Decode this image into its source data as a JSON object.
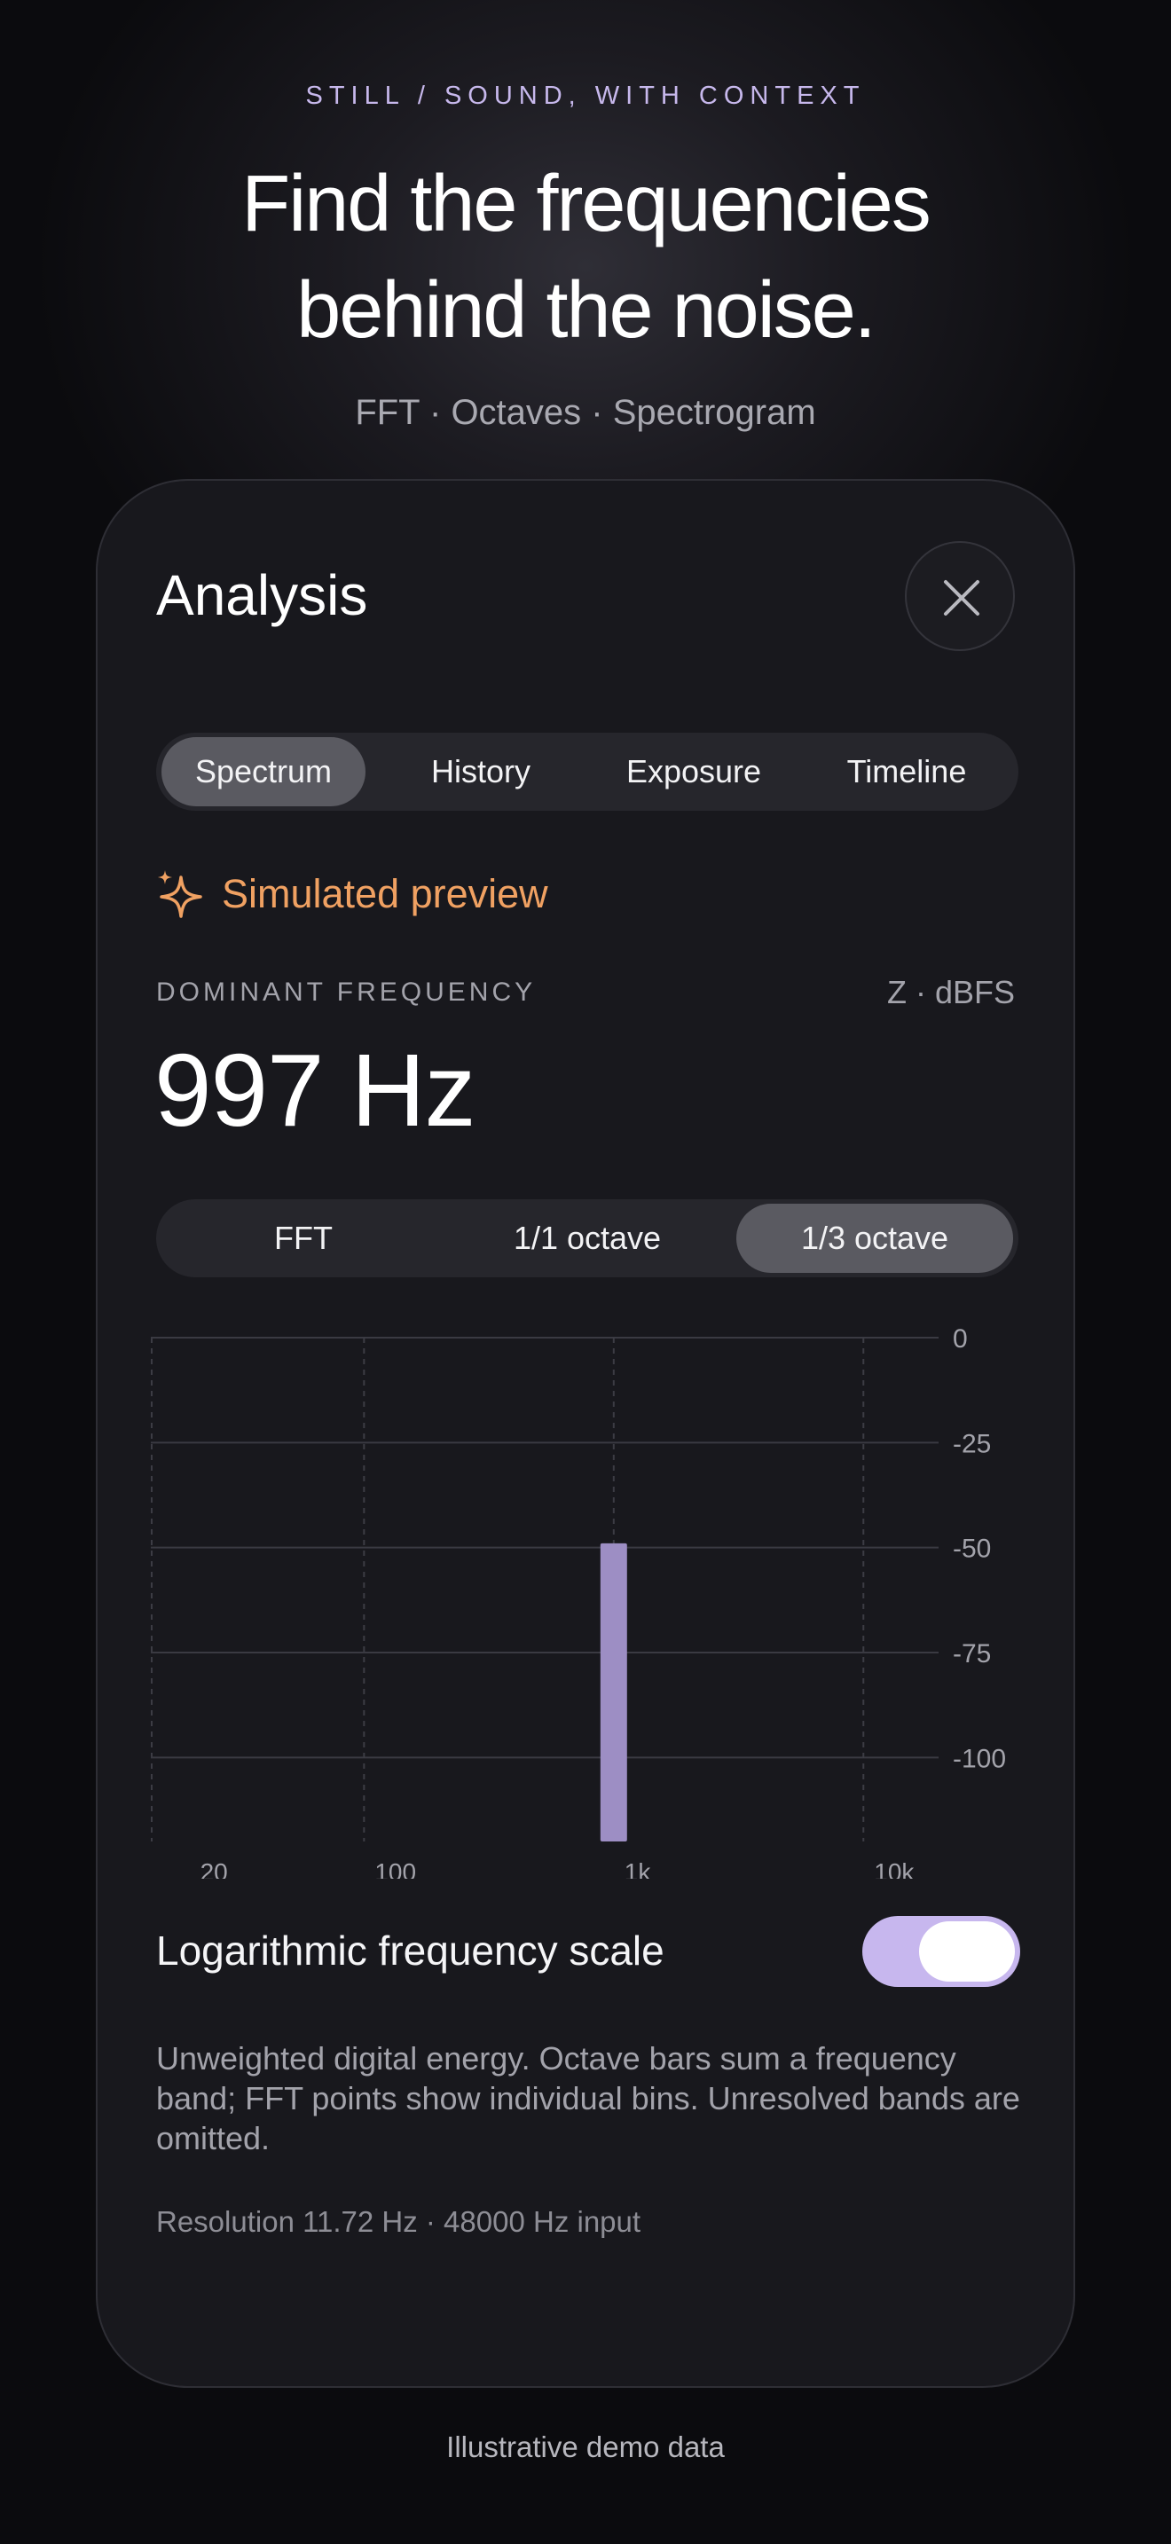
{
  "hero": {
    "eyebrow": "STILL / SOUND, WITH CONTEXT",
    "headline_line1": "Find the frequencies",
    "headline_line2": "behind the noise.",
    "subline": "FFT · Octaves · Spectrogram"
  },
  "panel": {
    "title": "Analysis",
    "close_icon": "close-icon",
    "tabs": [
      {
        "label": "Spectrum",
        "active": true
      },
      {
        "label": "History",
        "active": false
      },
      {
        "label": "Exposure",
        "active": false
      },
      {
        "label": "Timeline",
        "active": false
      }
    ],
    "preview_label": "Simulated preview",
    "preview_icon": "sparkles-icon",
    "dominant_label": "DOMINANT FREQUENCY",
    "weighting": "Z · dBFS",
    "dominant_value": "997 Hz",
    "modes": [
      {
        "label": "FFT",
        "active": false
      },
      {
        "label": "1/1 octave",
        "active": false
      },
      {
        "label": "1/3 octave",
        "active": true
      }
    ],
    "toggle_label": "Logarithmic frequency scale",
    "toggle_on": true,
    "description": "Unweighted digital energy. Octave bars sum a frequency band; FFT points show individual bins. Unresolved bands are omitted.",
    "resolution": "Resolution 11.72 Hz · 48000 Hz input"
  },
  "footer": "Illustrative demo data",
  "colors": {
    "accent": "#c7b7ee",
    "bar": "#9d8ec4",
    "preview": "#f0a162",
    "card": "#18181d"
  },
  "chart_data": {
    "type": "bar",
    "x_scale": "log",
    "xlim": [
      14,
      20000
    ],
    "ylim": [
      -120,
      0
    ],
    "x_ticks": [
      20,
      100,
      1000,
      10000
    ],
    "x_tick_labels": [
      "20",
      "100",
      "1k",
      "10k"
    ],
    "y_ticks": [
      0,
      -25,
      -50,
      -75,
      -100
    ],
    "y_tick_labels": [
      "0",
      "-25",
      "-50",
      "-75",
      "-100"
    ],
    "grid": true,
    "series": [
      {
        "x": [
          1000
        ],
        "values": [
          -49
        ]
      }
    ]
  }
}
